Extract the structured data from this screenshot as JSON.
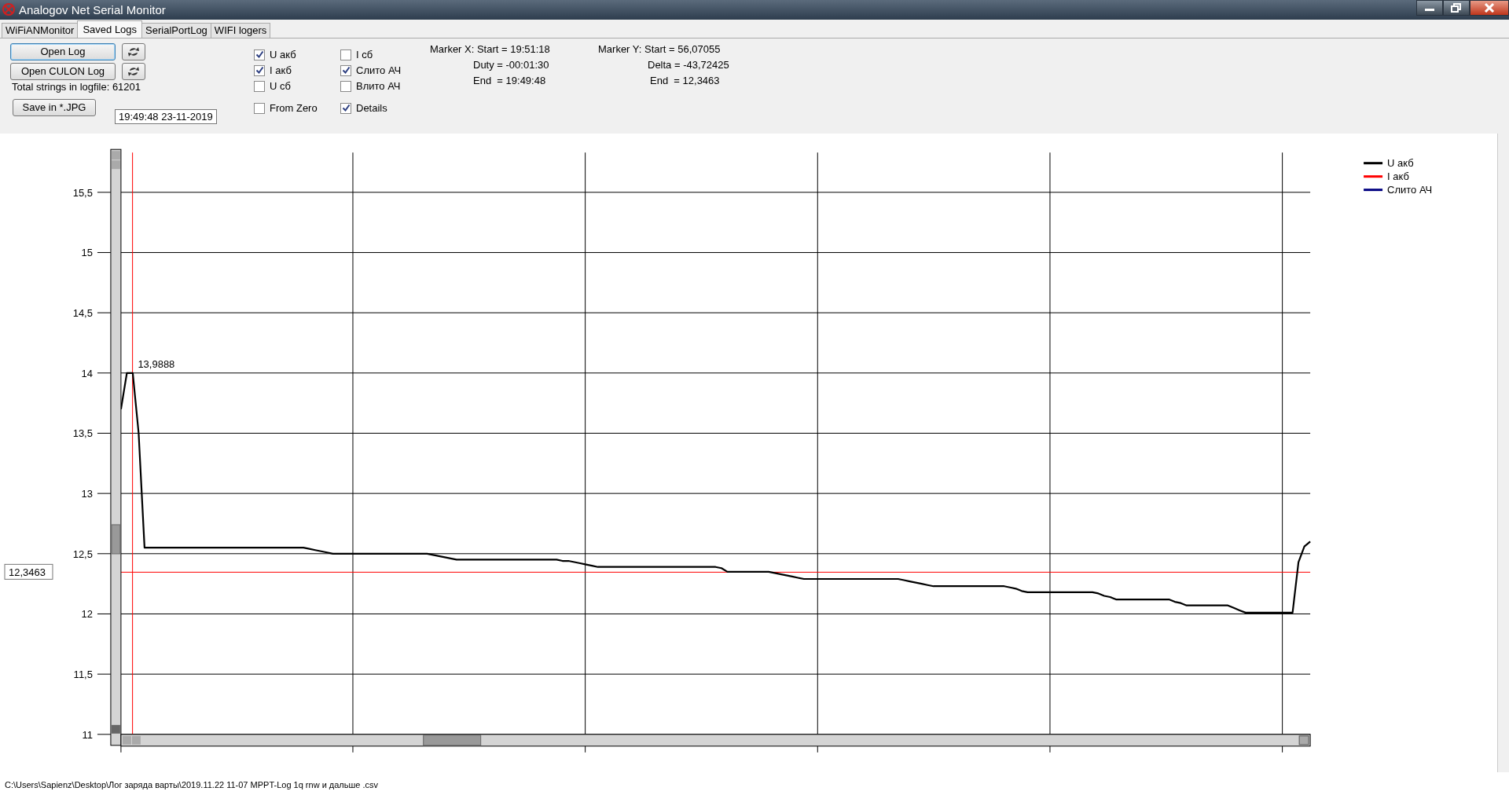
{
  "window": {
    "title": "Analogov Net Serial Monitor"
  },
  "tabs": [
    {
      "label": "WiFiANMonitor",
      "selected": false
    },
    {
      "label": "Saved Logs",
      "selected": true
    },
    {
      "label": "SerialPortLog",
      "selected": false
    },
    {
      "label": "WIFI logers",
      "selected": false
    }
  ],
  "controls": {
    "open_log": "Open Log",
    "open_culon_log": "Open CULON Log",
    "total_strings": "Total strings in logfile: 61201",
    "save": "Save in *.JPG",
    "marker_x_time": "19:49:48 23-11-2019"
  },
  "checkboxes": [
    {
      "label": "U акб",
      "checked": true
    },
    {
      "label": "I сб",
      "checked": false
    },
    {
      "label": "I акб",
      "checked": true
    },
    {
      "label": "Слито АЧ",
      "checked": true
    },
    {
      "label": "U сб",
      "checked": false
    },
    {
      "label": "Влито АЧ",
      "checked": false
    },
    {
      "label": "From Zero",
      "checked": false
    },
    {
      "label": "Details",
      "checked": true
    }
  ],
  "marker_x": [
    "Marker X: Start = 19:51:18",
    "Duty = -00:01:30",
    "End  = 19:49:48"
  ],
  "marker_y": [
    "Marker Y: Start = 56,07055",
    "Delta = -43,72425",
    "End  = 12,3463"
  ],
  "chart": {
    "marker_y_value": "12,3463",
    "peak_label": "13,9888",
    "chart_data": {
      "type": "line",
      "ylim": [
        11,
        15.83
      ],
      "categories": [
        null,
        null,
        null,
        null,
        null,
        null,
        null,
        null,
        null,
        null,
        null,
        null,
        null,
        null,
        null,
        null,
        null,
        null,
        null,
        null,
        null,
        null,
        null,
        null,
        null,
        null,
        null,
        null,
        null,
        null,
        null,
        null,
        null,
        null,
        null,
        null,
        null,
        null,
        null,
        null,
        null,
        null,
        null,
        null,
        null,
        null,
        null,
        null,
        null,
        null,
        null,
        null,
        null,
        null,
        null,
        null,
        null,
        null,
        null,
        null,
        null,
        null,
        null,
        null,
        null,
        null,
        null,
        null,
        null,
        null,
        null,
        null,
        null,
        null,
        null,
        null,
        null,
        null,
        null,
        null,
        null,
        null,
        null,
        null,
        null,
        null,
        null,
        null,
        null,
        null,
        null,
        null,
        null,
        null,
        null,
        null,
        null,
        null,
        null,
        null,
        null,
        null,
        null,
        null,
        null,
        null,
        null,
        null,
        null,
        null,
        null,
        null,
        null,
        null,
        null,
        null,
        null,
        null,
        null,
        null,
        null,
        null,
        null,
        null,
        null,
        null,
        null,
        null,
        null,
        null,
        null,
        null,
        null,
        null,
        null,
        null,
        null,
        null,
        null,
        null,
        null,
        null,
        null,
        null,
        null,
        null,
        null,
        null,
        null,
        null,
        null,
        null,
        null,
        null,
        null,
        null,
        null,
        null,
        null,
        null,
        null,
        null,
        null,
        null,
        null,
        null,
        null,
        null,
        null,
        null,
        null,
        null,
        null,
        null,
        null,
        null,
        null,
        null,
        null,
        null,
        null,
        null,
        null,
        null,
        null,
        null,
        null,
        null,
        null,
        null,
        null,
        null,
        null,
        null,
        null,
        null,
        null,
        null,
        null,
        null,
        null,
        null,
        null
      ],
      "yticks": [
        {
          "value": 11,
          "label": "11"
        },
        {
          "value": 11.5,
          "label": "11,5"
        },
        {
          "value": 12,
          "label": "12"
        },
        {
          "value": 12.5,
          "label": "12,5"
        },
        {
          "value": 13,
          "label": "13"
        },
        {
          "value": 13.5,
          "label": "13,5"
        },
        {
          "value": 14,
          "label": "14"
        },
        {
          "value": 14.5,
          "label": "14,5"
        },
        {
          "value": 15,
          "label": "15"
        },
        {
          "value": 15.5,
          "label": "15,5"
        }
      ],
      "series": [
        {
          "name": "U акб",
          "color": "#000000",
          "values": [
            13.7,
            14.0,
            14.0,
            13.5,
            12.55,
            12.55,
            12.55,
            12.55,
            12.55,
            12.55,
            12.55,
            12.55,
            12.55,
            12.55,
            12.55,
            12.55,
            12.55,
            12.55,
            12.55,
            12.55,
            12.55,
            12.55,
            12.55,
            12.55,
            12.55,
            12.55,
            12.55,
            12.55,
            12.55,
            12.55,
            12.55,
            12.55,
            12.54,
            12.53,
            12.52,
            12.51,
            12.5,
            12.5,
            12.5,
            12.5,
            12.5,
            12.5,
            12.5,
            12.5,
            12.5,
            12.5,
            12.5,
            12.5,
            12.5,
            12.5,
            12.5,
            12.5,
            12.5,
            12.49,
            12.48,
            12.47,
            12.46,
            12.45,
            12.45,
            12.45,
            12.45,
            12.45,
            12.45,
            12.45,
            12.45,
            12.45,
            12.45,
            12.45,
            12.45,
            12.45,
            12.45,
            12.45,
            12.45,
            12.45,
            12.45,
            12.44,
            12.44,
            12.43,
            12.42,
            12.41,
            12.4,
            12.39,
            12.39,
            12.39,
            12.39,
            12.39,
            12.39,
            12.39,
            12.39,
            12.39,
            12.39,
            12.39,
            12.39,
            12.39,
            12.39,
            12.39,
            12.39,
            12.39,
            12.39,
            12.39,
            12.39,
            12.39,
            12.38,
            12.35,
            12.35,
            12.35,
            12.35,
            12.35,
            12.35,
            12.35,
            12.35,
            12.34,
            12.33,
            12.32,
            12.31,
            12.3,
            12.29,
            12.29,
            12.29,
            12.29,
            12.29,
            12.29,
            12.29,
            12.29,
            12.29,
            12.29,
            12.29,
            12.29,
            12.29,
            12.29,
            12.29,
            12.29,
            12.29,
            12.28,
            12.27,
            12.26,
            12.25,
            12.24,
            12.23,
            12.23,
            12.23,
            12.23,
            12.23,
            12.23,
            12.23,
            12.23,
            12.23,
            12.23,
            12.23,
            12.23,
            12.23,
            12.22,
            12.21,
            12.19,
            12.18,
            12.18,
            12.18,
            12.18,
            12.18,
            12.18,
            12.18,
            12.18,
            12.18,
            12.18,
            12.18,
            12.18,
            12.17,
            12.15,
            12.14,
            12.12,
            12.12,
            12.12,
            12.12,
            12.12,
            12.12,
            12.12,
            12.12,
            12.12,
            12.12,
            12.1,
            12.09,
            12.07,
            12.07,
            12.07,
            12.07,
            12.07,
            12.07,
            12.07,
            12.07,
            12.05,
            12.03,
            12.01,
            12.01,
            12.01,
            12.01,
            12.01,
            12.01,
            12.01,
            12.01,
            12.01,
            12.43,
            12.56,
            12.6
          ]
        },
        {
          "name": "I акб",
          "color": "#ff0000",
          "values": [
            null,
            null,
            null,
            null,
            null,
            null,
            null,
            null,
            null,
            null,
            null,
            null,
            null,
            null,
            null,
            null,
            null,
            null,
            null,
            null,
            null,
            null,
            null,
            null,
            null,
            null,
            null,
            null,
            null,
            null,
            null,
            null,
            null,
            null,
            null,
            null,
            null,
            null,
            null,
            null,
            null,
            null,
            null,
            null,
            null,
            null,
            null,
            null,
            null,
            null,
            null,
            null,
            null,
            null,
            null,
            null,
            null,
            null,
            null,
            null,
            null,
            null,
            null,
            null,
            null,
            null,
            null,
            null,
            null,
            null,
            null,
            null,
            null,
            null,
            null,
            null,
            null,
            null,
            null,
            null,
            null,
            null,
            null,
            null,
            null,
            null,
            null,
            null,
            null,
            null,
            null,
            null,
            null,
            null,
            null,
            null,
            null,
            null,
            null,
            null,
            null,
            null,
            null,
            null,
            null,
            null,
            null,
            null,
            null,
            null,
            null,
            null,
            null,
            null,
            null,
            null,
            null,
            null,
            null,
            null,
            null,
            null,
            null,
            null,
            null,
            null,
            null,
            null,
            null,
            null,
            null,
            null,
            null,
            null,
            null,
            null,
            null,
            null,
            null,
            null,
            null,
            null,
            null,
            null,
            null,
            null,
            null,
            null,
            null,
            null,
            null,
            null,
            null,
            null,
            null,
            null,
            null,
            null,
            null,
            null,
            null,
            null,
            null,
            null,
            null,
            null,
            null,
            null,
            null,
            null,
            null,
            null,
            null,
            null,
            null,
            null,
            null,
            null,
            null,
            null,
            null,
            null,
            null,
            null,
            null,
            null,
            null,
            null,
            null,
            null,
            null,
            null,
            null,
            null,
            null,
            null,
            null,
            null,
            null,
            null,
            null,
            null,
            null
          ]
        },
        {
          "name": "Слито АЧ",
          "color": "#000080",
          "values": [
            null,
            null,
            null,
            null,
            null,
            null,
            null,
            null,
            null,
            null,
            null,
            null,
            null,
            null,
            null,
            null,
            null,
            null,
            null,
            null,
            null,
            null,
            null,
            null,
            null,
            null,
            null,
            null,
            null,
            null,
            null,
            null,
            null,
            null,
            null,
            null,
            null,
            null,
            null,
            null,
            null,
            null,
            null,
            null,
            null,
            null,
            null,
            null,
            null,
            null,
            null,
            null,
            null,
            null,
            null,
            null,
            null,
            null,
            null,
            null,
            null,
            null,
            null,
            null,
            null,
            null,
            null,
            null,
            null,
            null,
            null,
            null,
            null,
            null,
            null,
            null,
            null,
            null,
            null,
            null,
            null,
            null,
            null,
            null,
            null,
            null,
            null,
            null,
            null,
            null,
            null,
            null,
            null,
            null,
            null,
            null,
            null,
            null,
            null,
            null,
            null,
            null,
            null,
            null,
            null,
            null,
            null,
            null,
            null,
            null,
            null,
            null,
            null,
            null,
            null,
            null,
            null,
            null,
            null,
            null,
            null,
            null,
            null,
            null,
            null,
            null,
            null,
            null,
            null,
            null,
            null,
            null,
            null,
            null,
            null,
            null,
            null,
            null,
            null,
            null,
            null,
            null,
            null,
            null,
            null,
            null,
            null,
            null,
            null,
            null,
            null,
            null,
            null,
            null,
            null,
            null,
            null,
            null,
            null,
            null,
            null,
            null,
            null,
            null,
            null,
            null,
            null,
            null,
            null,
            null,
            null,
            null,
            null,
            null,
            null,
            null,
            null,
            null,
            null,
            null,
            null,
            null,
            null,
            null,
            null,
            null,
            null,
            null,
            null,
            null,
            null,
            null,
            null,
            null,
            null,
            null,
            null,
            null,
            null,
            null,
            null,
            null,
            null
          ]
        }
      ],
      "grid": true,
      "ref_lines": [
        {
          "axis": "y",
          "value": 12.3463,
          "color": "#ff0000"
        }
      ]
    }
  },
  "status_bar": "C:\\Users\\Sapienz\\Desktop\\Лог заряда варты\\2019.11.22 11-07 MPPT-Log 1q rnw и дальше .csv"
}
